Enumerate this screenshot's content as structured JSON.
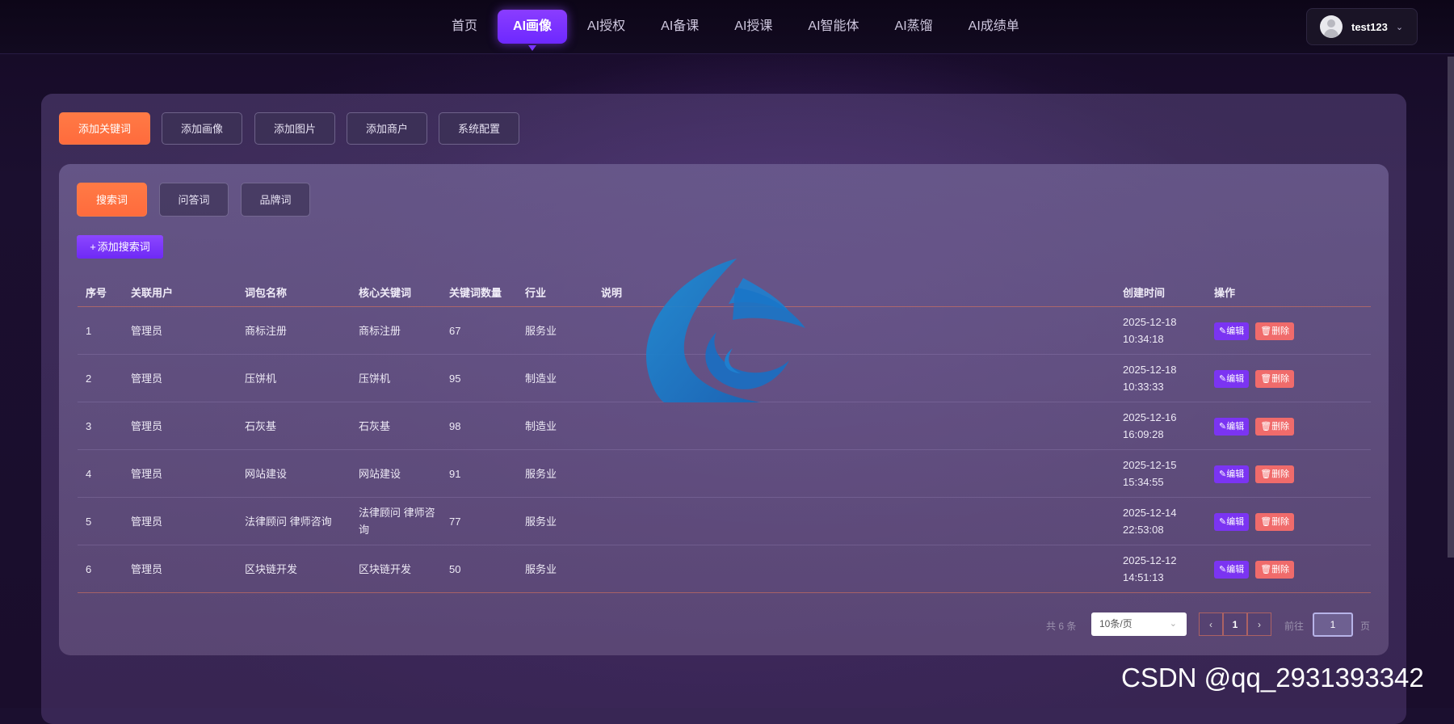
{
  "nav": {
    "items": [
      "首页",
      "AI画像",
      "AI授权",
      "AI备课",
      "AI授课",
      "AI智能体",
      "AI蒸馏",
      "AI成绩单"
    ],
    "active_index": 1
  },
  "user": {
    "name": "test123"
  },
  "toolbar": [
    "添加关键词",
    "添加画像",
    "添加图片",
    "添加商户",
    "系统配置"
  ],
  "subtabs": [
    "搜索词",
    "问答词",
    "品牌词"
  ],
  "add_button": "添加搜索词",
  "table": {
    "headers": [
      "序号",
      "关联用户",
      "词包名称",
      "核心关键词",
      "关键词数量",
      "行业",
      "说明",
      "创建时间",
      "操作"
    ],
    "rows": [
      {
        "no": "1",
        "user": "管理员",
        "pack": "商标注册",
        "core": "商标注册",
        "count": "67",
        "industry": "服务业",
        "desc": "",
        "date": "2025-12-18",
        "time": "10:34:18"
      },
      {
        "no": "2",
        "user": "管理员",
        "pack": "压饼机",
        "core": "压饼机",
        "count": "95",
        "industry": "制造业",
        "desc": "",
        "date": "2025-12-18",
        "time": "10:33:33"
      },
      {
        "no": "3",
        "user": "管理员",
        "pack": "石灰基",
        "core": "石灰基",
        "count": "98",
        "industry": "制造业",
        "desc": "",
        "date": "2025-12-16",
        "time": "16:09:28"
      },
      {
        "no": "4",
        "user": "管理员",
        "pack": "网站建设",
        "core": "网站建设",
        "count": "91",
        "industry": "服务业",
        "desc": "",
        "date": "2025-12-15",
        "time": "15:34:55"
      },
      {
        "no": "5",
        "user": "管理员",
        "pack": "法律顾问 律师咨询",
        "core": "法律顾问 律师咨询",
        "count": "77",
        "industry": "服务业",
        "desc": "",
        "date": "2025-12-14",
        "time": "22:53:08"
      },
      {
        "no": "6",
        "user": "管理员",
        "pack": "区块链开发",
        "core": "区块链开发",
        "count": "50",
        "industry": "服务业",
        "desc": "",
        "date": "2025-12-12",
        "time": "14:51:13"
      }
    ],
    "edit_label": "编辑",
    "delete_label": "删除"
  },
  "pagination": {
    "total": "共 6 条",
    "page_size": "10条/页",
    "current": "1",
    "goto_prefix": "前往",
    "goto_value": "1",
    "goto_suffix": "页"
  },
  "watermark": "CSDN @qq_2931393342",
  "colors": {
    "accent": "#7b34f2",
    "orange": "#ff7a45",
    "danger": "#f06b6b"
  }
}
